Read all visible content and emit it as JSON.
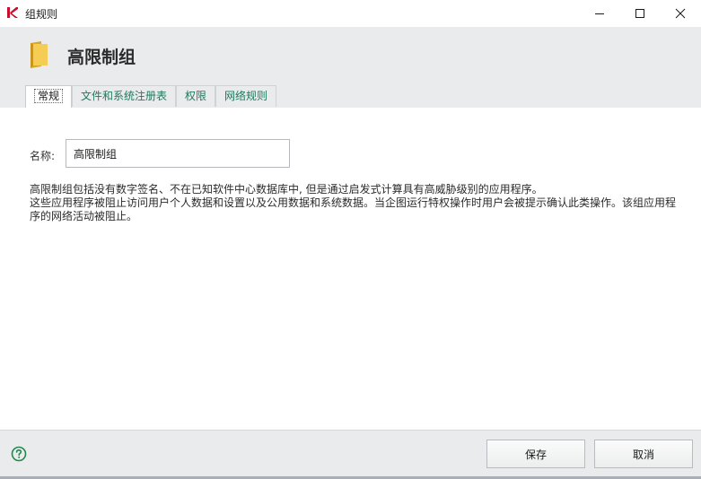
{
  "window": {
    "title": "组规则",
    "controls": [
      "minimize",
      "maximize",
      "close"
    ]
  },
  "header": {
    "icon": "folder-icon",
    "title": "高限制组"
  },
  "tabs": [
    {
      "label": "常规",
      "active": true
    },
    {
      "label": "文件和系统注册表",
      "active": false
    },
    {
      "label": "权限",
      "active": false
    },
    {
      "label": "网络规则",
      "active": false
    }
  ],
  "form": {
    "name_label": "名称:",
    "name_value": "高限制组"
  },
  "description": {
    "line1": "高限制组包括没有数字签名、不在已知软件中心数据库中, 但是通过启发式计算具有高威胁级别的应用程序。",
    "line2": "这些应用程序被阻止访问用户个人数据和设置以及公用数据和系统数据。当企图运行特权操作时用户会被提示确认此类操作。该组应用程序的网络活动被阻止。"
  },
  "footer": {
    "help_icon": "help-icon",
    "save_label": "保存",
    "cancel_label": "取消"
  },
  "colors": {
    "accent_green": "#1f7a5a",
    "logo_red": "#c8102e",
    "header_bg": "#e9ebed",
    "folder_yellow": "#f2c94c"
  }
}
